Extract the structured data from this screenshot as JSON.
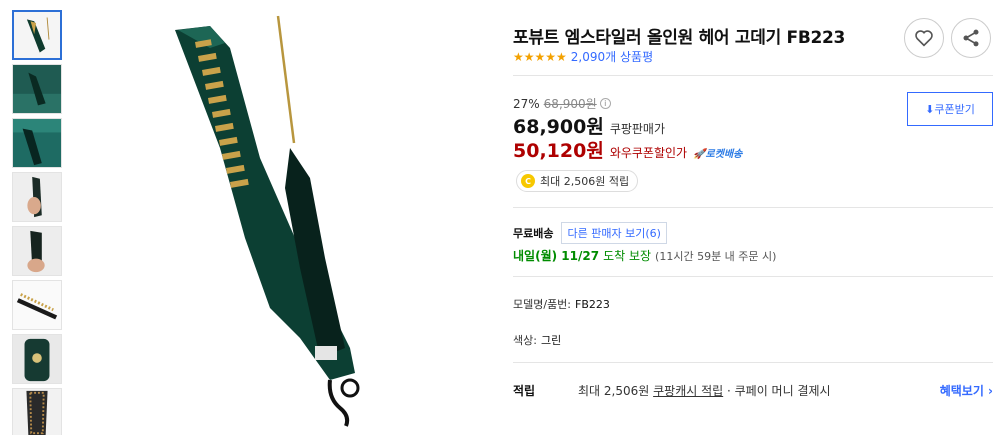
{
  "thumbnails": [
    {
      "name": "thumb-product-front",
      "active": true
    },
    {
      "name": "thumb-product-green-bg"
    },
    {
      "name": "thumb-product-teal-bg"
    },
    {
      "name": "thumb-hand-hold-1"
    },
    {
      "name": "thumb-hand-hold-2"
    },
    {
      "name": "thumb-bristles"
    },
    {
      "name": "thumb-control-button"
    },
    {
      "name": "thumb-comb-detail"
    }
  ],
  "product": {
    "title": "포뷰트 엠스타일러 올인원 헤어 고데기 FB223",
    "stars": "★★★★★",
    "review_count": "2,090개 상품평"
  },
  "pricing": {
    "discount_rate": "27%",
    "original_price": "68,900원",
    "info_icon": "i",
    "price": "68,900원",
    "price_label": "쿠팡판매가",
    "coupon_price": "50,120원",
    "coupon_label": "와우쿠폰할인가",
    "rocket_label": "🚀로켓배송",
    "coupon_button": "⬇쿠폰받기",
    "cash_coin": "C",
    "cash_reward": "최대 2,506원 적립"
  },
  "shipping": {
    "label": "무료배송",
    "other_sellers": "다른 판매자 보기(6)",
    "arrival_date": "내일(월) 11/27",
    "arrival_guarantee": "도착 보장",
    "arrival_note": "(11시간 59분 내 주문 시)"
  },
  "specs": {
    "model_label": "모델명/품번:",
    "model_value": "FB223",
    "color_label": "색상:",
    "color_value": "그린"
  },
  "benefit": {
    "label": "적립",
    "text_prefix": "최대 2,506원 ",
    "text_link": "쿠팡캐시 적립",
    "text_suffix": " · 쿠페이 머니 결제시",
    "more_link": "혜택보기 ›"
  },
  "colors": {
    "link_blue": "#346aff",
    "sale_red": "#ae0000",
    "arrival_green": "#008c00",
    "star_orange": "#f3a100"
  }
}
